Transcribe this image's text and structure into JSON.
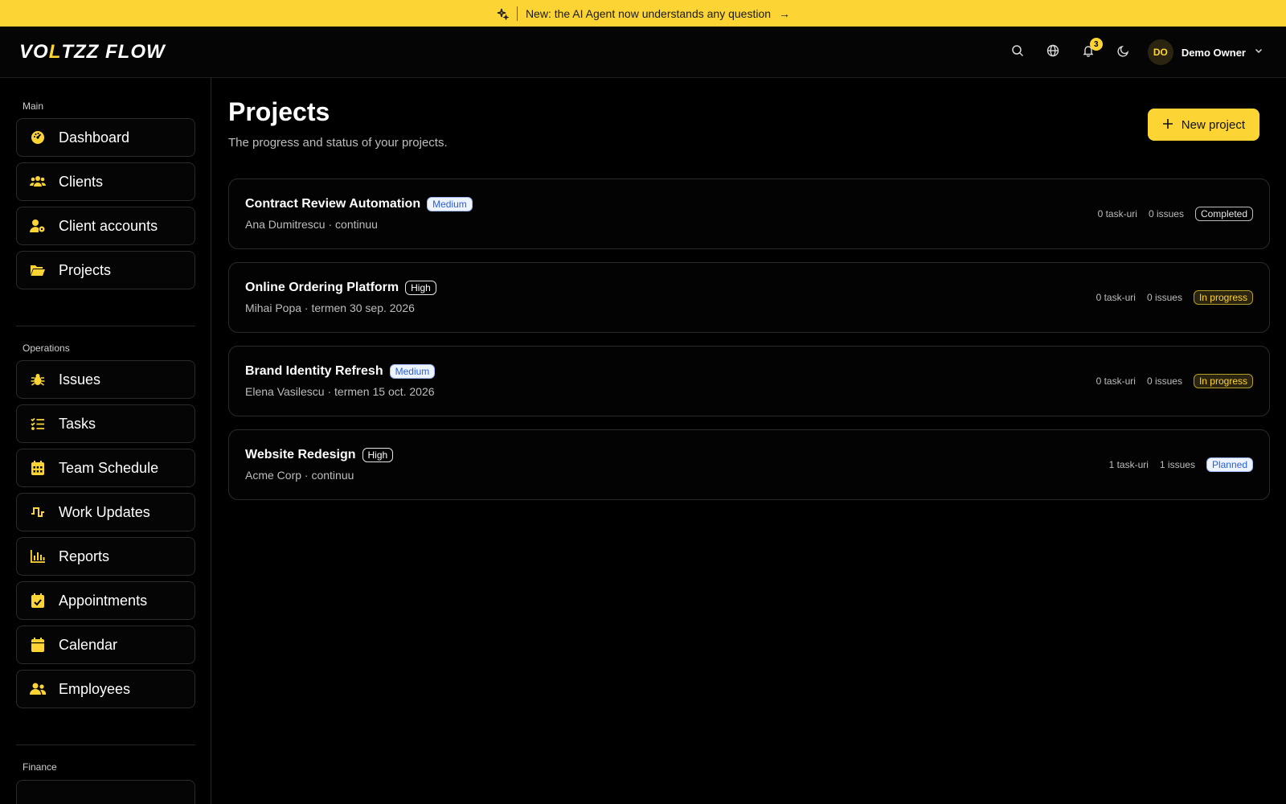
{
  "banner": {
    "text": "New: the AI Agent now understands any question",
    "arrow": "→",
    "icon": "sparkles-icon"
  },
  "header": {
    "logo": {
      "part1": "VO",
      "bolt": "L",
      "part2": "TZZ FLOW"
    },
    "icons": [
      "search-icon",
      "globe-icon",
      "bell-icon",
      "moon-icon"
    ],
    "notifications_count": "3",
    "user": {
      "initials": "DO",
      "name": "Demo Owner"
    }
  },
  "sidebar": {
    "sections": [
      {
        "label": "Main",
        "items": [
          {
            "label": "Dashboard",
            "icon": "dashboard-icon"
          },
          {
            "label": "Clients",
            "icon": "clients-icon"
          },
          {
            "label": "Client accounts",
            "icon": "client-accounts-icon"
          },
          {
            "label": "Projects",
            "icon": "folder-open-icon"
          }
        ]
      },
      {
        "label": "Operations",
        "items": [
          {
            "label": "Issues",
            "icon": "bug-icon"
          },
          {
            "label": "Tasks",
            "icon": "list-check-icon"
          },
          {
            "label": "Team Schedule",
            "icon": "calendar-grid-icon"
          },
          {
            "label": "Work Updates",
            "icon": "pulse-icon"
          },
          {
            "label": "Reports",
            "icon": "bar-chart-icon"
          },
          {
            "label": "Appointments",
            "icon": "calendar-check-icon"
          },
          {
            "label": "Calendar",
            "icon": "calendar-icon"
          },
          {
            "label": "Employees",
            "icon": "users-icon"
          }
        ]
      },
      {
        "label": "Finance",
        "items": []
      }
    ]
  },
  "main": {
    "title": "Projects",
    "subtitle": "The progress and status of your projects.",
    "new_button": "New project",
    "projects": [
      {
        "name": "Contract Review Automation",
        "priority": "Medium",
        "meta": "Ana Dumitrescu · continuu",
        "tasks": "0 task-uri",
        "issues": "0 issues",
        "status": "Completed"
      },
      {
        "name": "Online Ordering Platform",
        "priority": "High",
        "meta": "Mihai Popa · termen 30 sep. 2026",
        "tasks": "0 task-uri",
        "issues": "0 issues",
        "status": "In progress"
      },
      {
        "name": "Brand Identity Refresh",
        "priority": "Medium",
        "meta": "Elena Vasilescu · termen 15 oct. 2026",
        "tasks": "0 task-uri",
        "issues": "0 issues",
        "status": "In progress"
      },
      {
        "name": "Website Redesign",
        "priority": "High",
        "meta": "Acme Corp · continuu",
        "tasks": "1 task-uri",
        "issues": "1 issues",
        "status": "Planned"
      }
    ]
  },
  "colors": {
    "accent": "#fcd535",
    "background": "#000000",
    "planned_blue": "#2a5fd8"
  }
}
